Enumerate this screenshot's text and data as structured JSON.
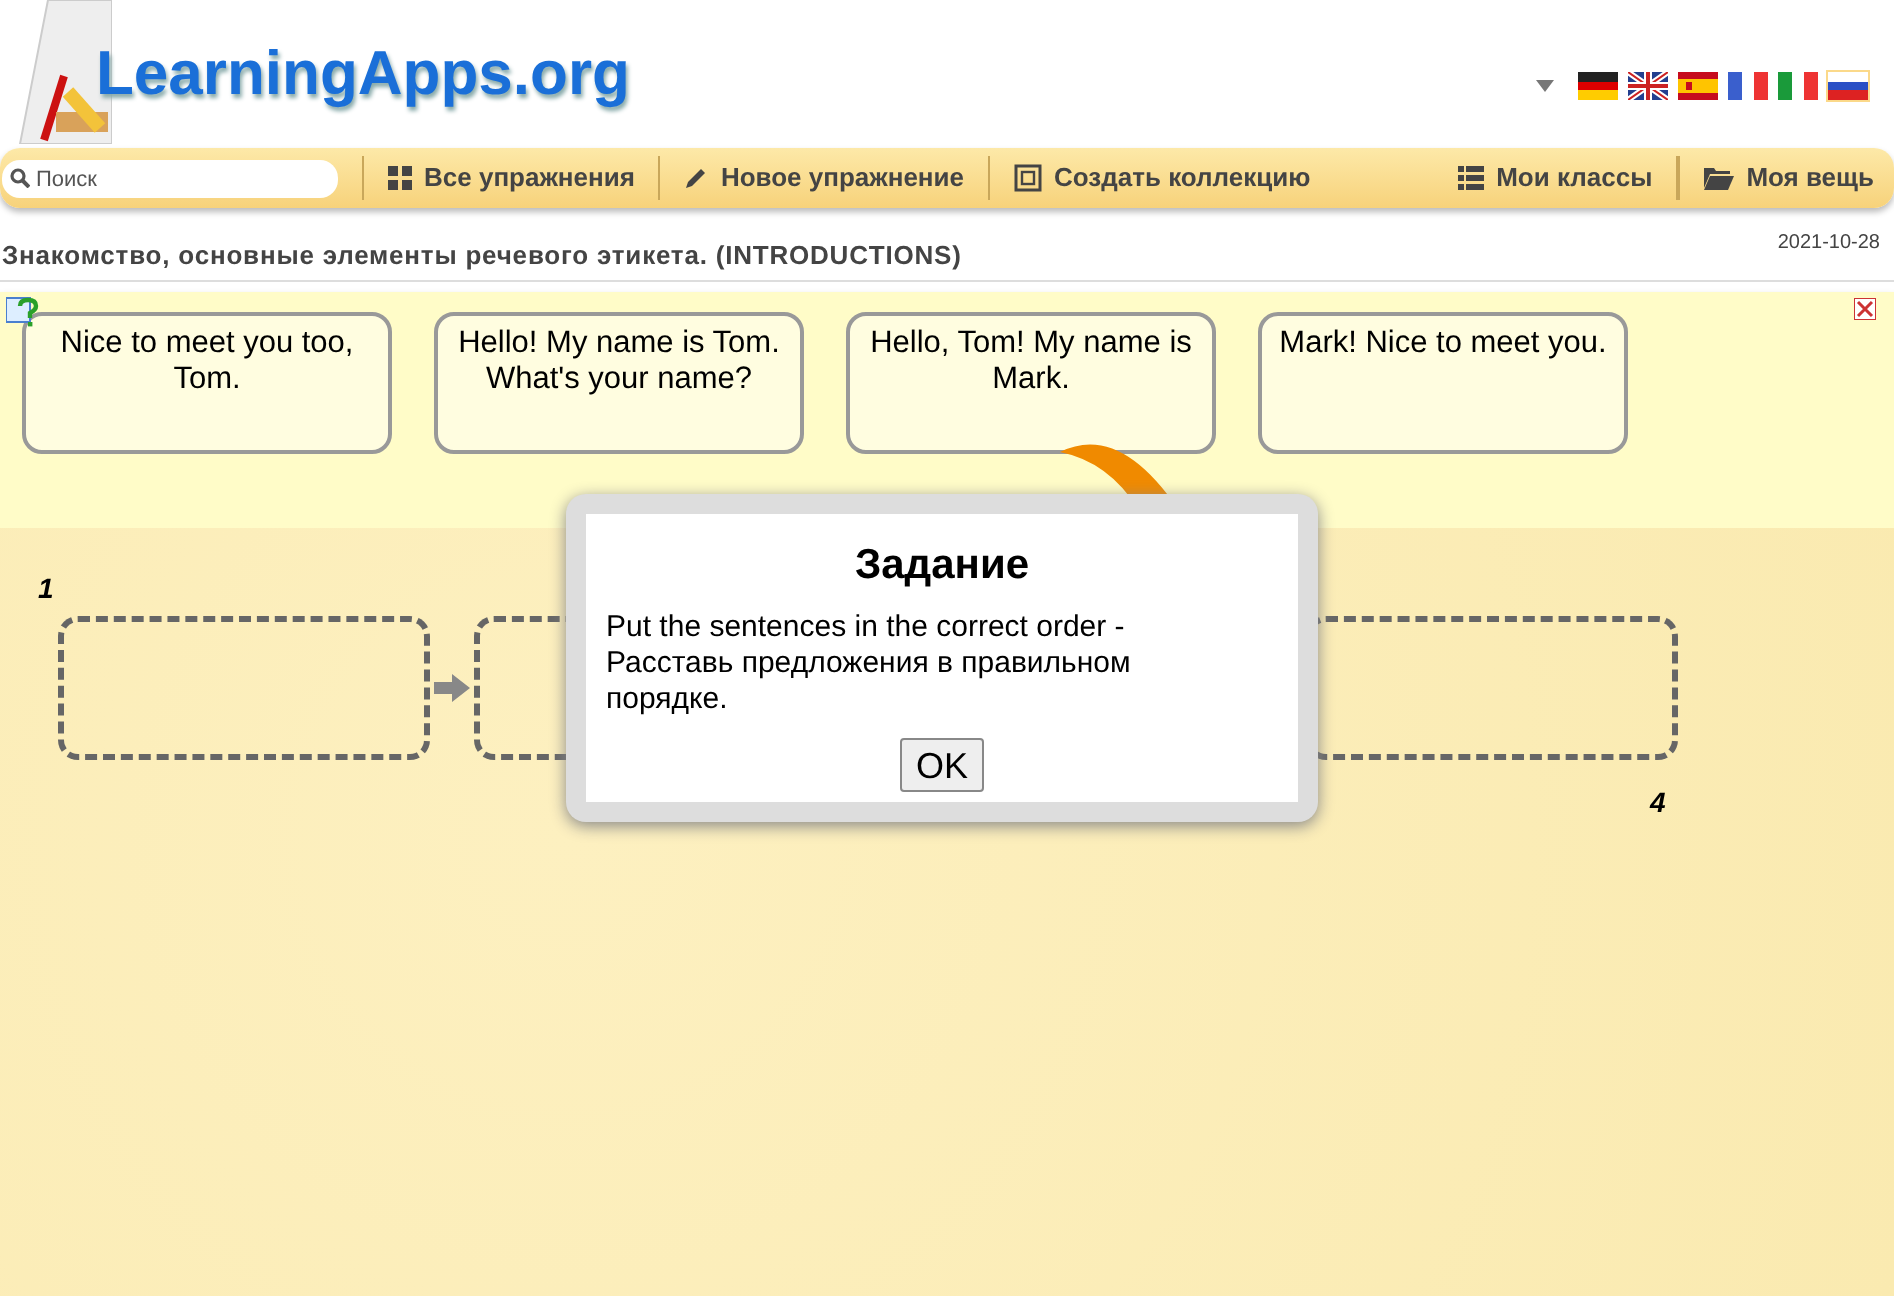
{
  "logo": {
    "text": "LearningApps.org"
  },
  "languages": [
    {
      "kind": "de",
      "selected": false
    },
    {
      "kind": "gb",
      "selected": false
    },
    {
      "kind": "es",
      "selected": false
    },
    {
      "kind": "fr",
      "selected": false
    },
    {
      "kind": "it",
      "selected": false
    },
    {
      "kind": "ru",
      "selected": true
    }
  ],
  "search": {
    "placeholder": "Поиск"
  },
  "nav": [
    {
      "label": "Все упражнения",
      "kind": "grid"
    },
    {
      "label": "Новое упражнение",
      "kind": "pencil"
    },
    {
      "label": "Создать коллекцию",
      "kind": "collection"
    },
    {
      "label": "Мои классы",
      "kind": "list"
    },
    {
      "label": "Моя вещь",
      "kind": "folder"
    }
  ],
  "page": {
    "title": "Знакомство, основные элементы речевого этикета. (INTRODUCTIONS)",
    "date": "2021-10-28"
  },
  "cards": [
    {
      "text": "Nice to meet you too, Tom."
    },
    {
      "text": "Hello! My name is Tom. What's your name?"
    },
    {
      "text": "Hello, Tom! My name is Mark."
    },
    {
      "text": "Mark! Nice to meet you."
    }
  ],
  "slots": {
    "first_label": "1",
    "last_label": "4"
  },
  "dialog": {
    "title": "Задание",
    "text": "Put the sentences in the correct order - Расставь предложения в правильном порядке.",
    "button": "OK"
  }
}
